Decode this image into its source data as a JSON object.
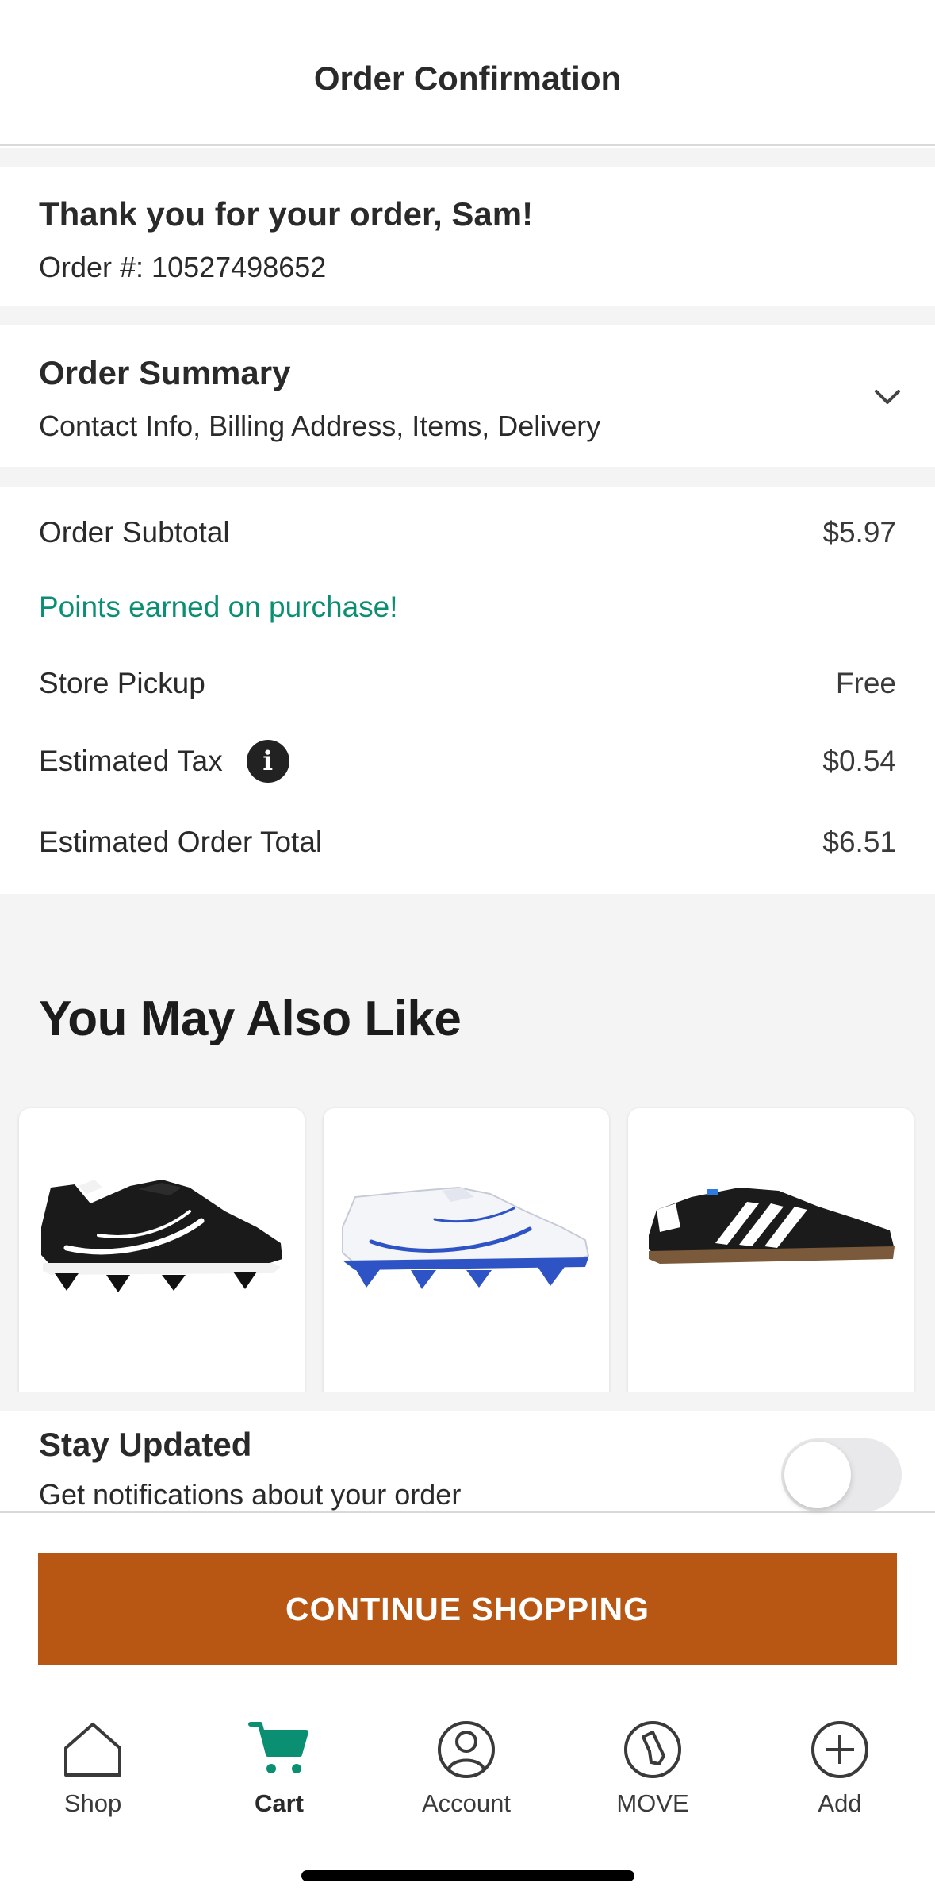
{
  "header": {
    "title": "Order Confirmation"
  },
  "thanks": {
    "title": "Thank you for your order, Sam!",
    "order_number": "Order #: 10527498652"
  },
  "summary": {
    "title": "Order Summary",
    "subtitle": "Contact Info, Billing Address, Items, Delivery",
    "icon": "chevron-down-icon"
  },
  "totals": {
    "subtotal_label": "Order Subtotal",
    "subtotal_value": "$5.97",
    "points_text": "Points earned on purchase!",
    "pickup_label": "Store Pickup",
    "pickup_value": "Free",
    "tax_label": "Estimated Tax",
    "tax_value": "$0.54",
    "tax_icon": "info-icon",
    "total_label": "Estimated Order Total",
    "total_value": "$6.51"
  },
  "recommendations": {
    "title": "You May Also Like",
    "products": [
      {
        "image": "black-cleat-image"
      },
      {
        "image": "white-blue-cleat-image"
      },
      {
        "image": "black-sneaker-image"
      }
    ]
  },
  "stay_updated": {
    "title": "Stay Updated",
    "subtitle": "Get notifications about your order",
    "toggle_on": false
  },
  "cta": {
    "label": "CONTINUE SHOPPING"
  },
  "nav": {
    "items": [
      {
        "label": "Shop",
        "icon": "home-icon"
      },
      {
        "label": "Cart",
        "icon": "cart-icon",
        "active": true
      },
      {
        "label": "Account",
        "icon": "account-icon"
      },
      {
        "label": "MOVE",
        "icon": "move-icon"
      },
      {
        "label": "Add",
        "icon": "add-icon"
      }
    ]
  },
  "colors": {
    "accent": "#b85613",
    "points_green": "#0b8f72",
    "cart_active": "#0b8f72"
  }
}
